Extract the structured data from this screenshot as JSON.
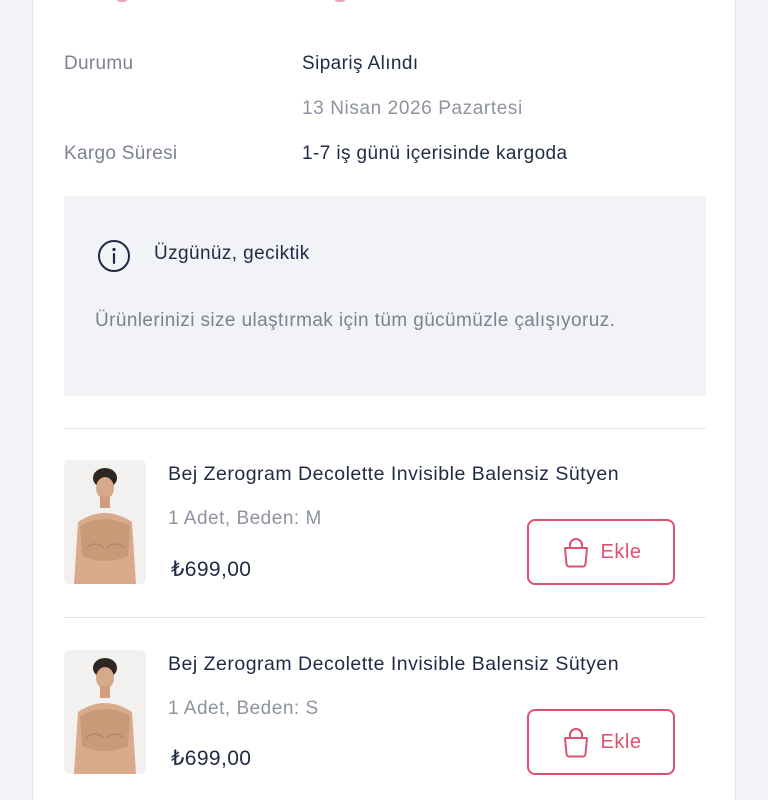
{
  "colors": {
    "accent": "#e0506f",
    "text_primary": "#1f2a44",
    "text_secondary": "#7c8291",
    "panel_bg": "#f2f3f6"
  },
  "order_info": {
    "status_label": "Durumu",
    "status_value": "Sipariş Alındı",
    "status_date": "13 Nisan 2026 Pazartesi",
    "shipping_label": "Kargo Süresi",
    "shipping_value": "1-7 iş günü içerisinde kargoda"
  },
  "notice": {
    "icon": "info-icon",
    "title": "Üzgünüz, geciktik",
    "message": "Ürünlerinizi size ulaştırmak için tüm gücümüzle çalışıyoruz."
  },
  "products": [
    {
      "name": "Bej Zerogram Decolette Invisible Balensiz Sütyen",
      "meta": "1 Adet, Beden: M",
      "price": "₺699,00",
      "add_label": "Ekle",
      "icon": "shopping-bag-icon"
    },
    {
      "name": "Bej Zerogram Decolette Invisible Balensiz Sütyen",
      "meta": "1 Adet, Beden: S",
      "price": "₺699,00",
      "add_label": "Ekle",
      "icon": "shopping-bag-icon"
    }
  ]
}
